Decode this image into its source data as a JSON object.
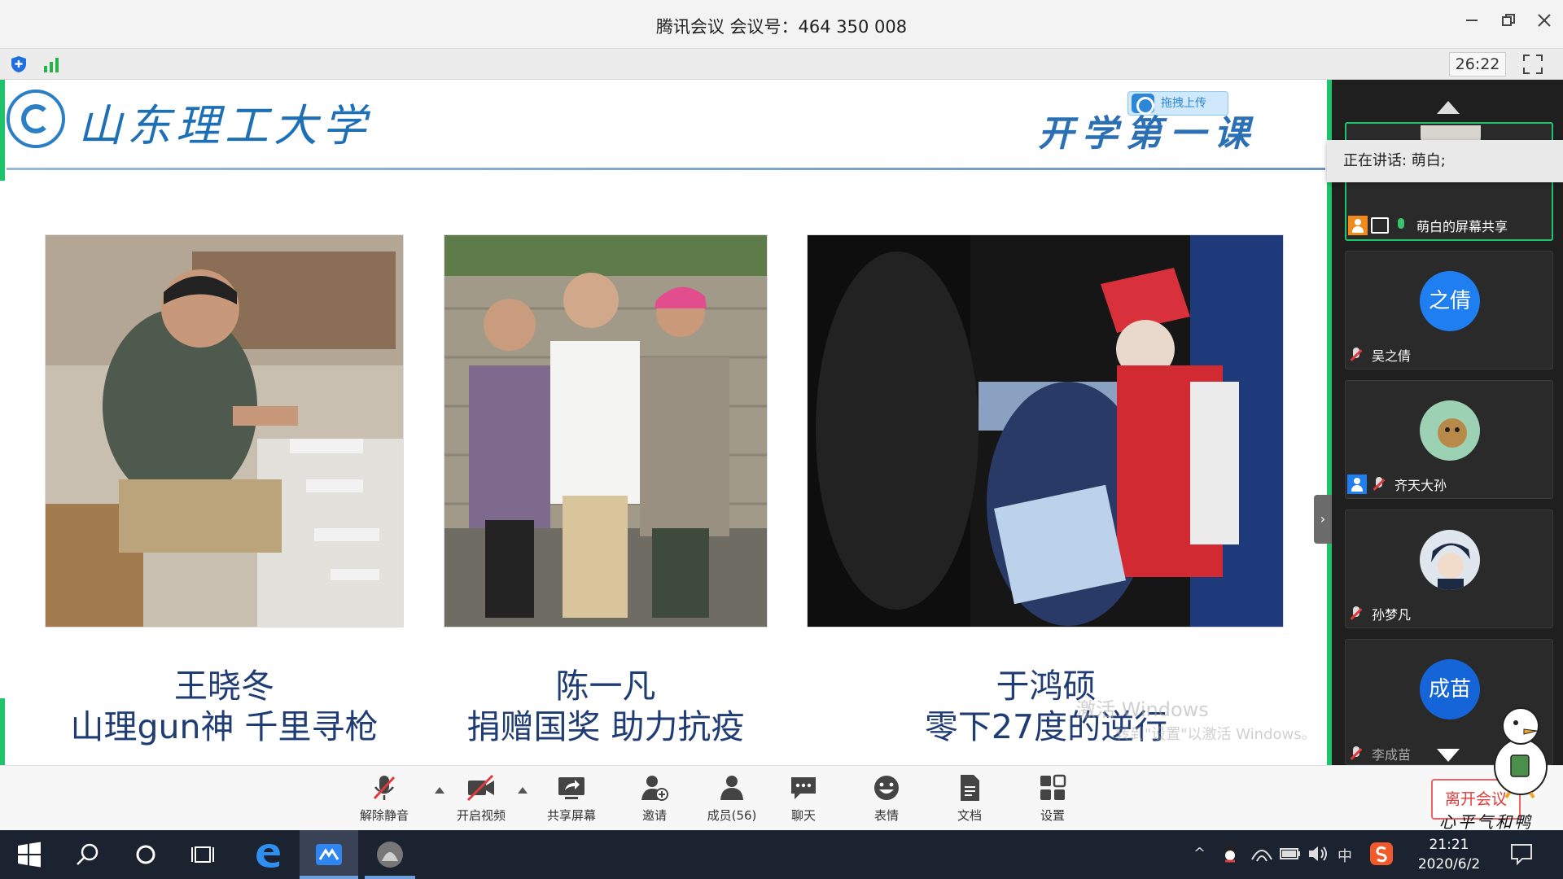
{
  "window": {
    "title": "腾讯会议 会议号：464 350 008",
    "controls": [
      "minimize",
      "restore",
      "close"
    ]
  },
  "topstrip": {
    "timer": "26:22",
    "icons": [
      "shield-icon",
      "signal-icon",
      "fullscreen-icon"
    ]
  },
  "slide": {
    "university": "山东理工大学",
    "lesson_title": "开学第一课",
    "upload_badge": "拖拽上传",
    "people": [
      {
        "name": "王晓冬",
        "desc": "山理gun神 千里寻枪"
      },
      {
        "name": "陈一凡",
        "desc": "捐赠国奖 助力抗疫"
      },
      {
        "name": "于鸿硕",
        "desc": "零下27度的逆行"
      }
    ],
    "watermark_line1": "激活 Windows",
    "watermark_line2": "转到\"设置\"以激活 Windows。"
  },
  "sidebar": {
    "speaking_label": "正在讲话: 萌白;",
    "participants": [
      {
        "name": "萌白的屏幕共享",
        "avatar_text": "",
        "mic": "on",
        "role": "host",
        "active": true
      },
      {
        "name": "吴之倩",
        "avatar_text": "之倩",
        "mic": "off",
        "role": "",
        "active": false
      },
      {
        "name": "齐天大孙",
        "avatar_text": "",
        "mic": "off",
        "role": "cohost",
        "active": false
      },
      {
        "name": "孙梦凡",
        "avatar_text": "",
        "mic": "off",
        "role": "",
        "active": false
      },
      {
        "name": "李成苗",
        "avatar_text": "成苗",
        "mic": "off",
        "role": "",
        "active": false
      }
    ]
  },
  "toolbar": {
    "buttons": [
      {
        "id": "unmute",
        "label": "解除静音",
        "icon": "mic-muted-icon"
      },
      {
        "id": "video",
        "label": "开启视频",
        "icon": "camera-off-icon"
      },
      {
        "id": "share",
        "label": "共享屏幕",
        "icon": "share-screen-icon"
      },
      {
        "id": "invite",
        "label": "邀请",
        "icon": "invite-icon"
      },
      {
        "id": "members",
        "label": "成员(56)",
        "icon": "members-icon"
      },
      {
        "id": "chat",
        "label": "聊天",
        "icon": "chat-icon"
      },
      {
        "id": "emoji",
        "label": "表情",
        "icon": "emoji-icon"
      },
      {
        "id": "docs",
        "label": "文档",
        "icon": "document-icon"
      },
      {
        "id": "settings",
        "label": "设置",
        "icon": "settings-icon"
      }
    ],
    "leave_label": "离开会议"
  },
  "taskbar": {
    "time": "21:21",
    "date": "2020/6/2",
    "ime": "中",
    "sticker_text": "心平气和鸭"
  }
}
